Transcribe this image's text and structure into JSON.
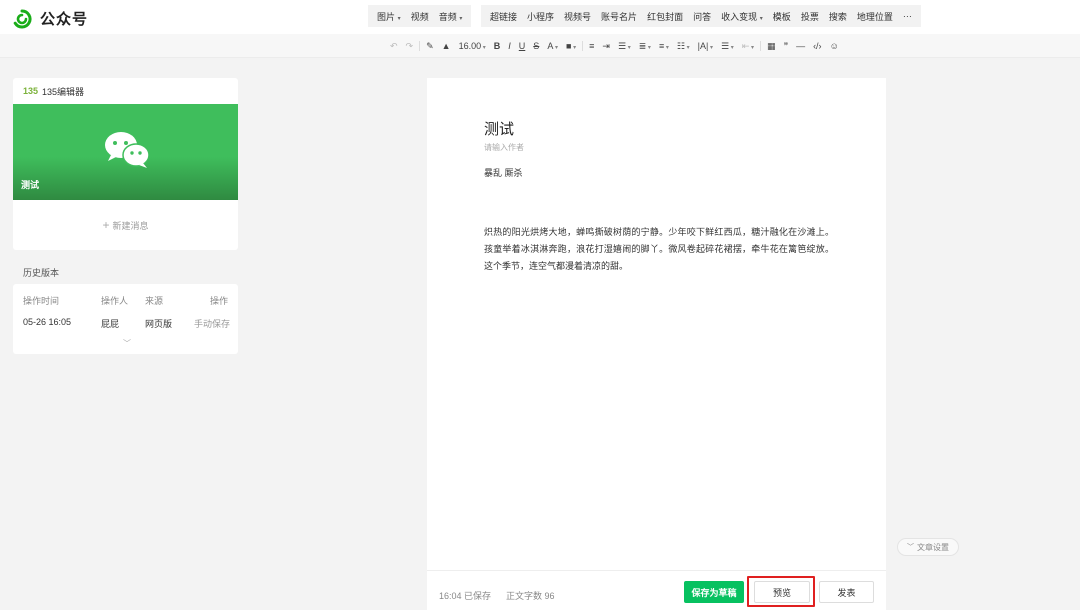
{
  "app": {
    "title": "公众号"
  },
  "topmenu": {
    "group1": [
      {
        "label": "图片",
        "dropdown": true
      },
      {
        "label": "视频",
        "dropdown": false
      },
      {
        "label": "音频",
        "dropdown": true
      }
    ],
    "group2": [
      {
        "label": "超链接",
        "dropdown": false
      },
      {
        "label": "小程序",
        "dropdown": false
      },
      {
        "label": "视频号",
        "dropdown": false
      },
      {
        "label": "账号名片",
        "dropdown": false
      },
      {
        "label": "红包封面",
        "dropdown": false
      },
      {
        "label": "问答",
        "dropdown": false
      },
      {
        "label": "收入变现",
        "dropdown": true
      },
      {
        "label": "模板",
        "dropdown": false
      },
      {
        "label": "投票",
        "dropdown": false
      },
      {
        "label": "搜索",
        "dropdown": false
      },
      {
        "label": "地理位置",
        "dropdown": false
      },
      {
        "label": "···",
        "dropdown": false
      }
    ]
  },
  "toolbar": {
    "font_size": "16.00",
    "icons": [
      "undo-icon",
      "redo-icon",
      "format-brush-icon",
      "clear-format-icon",
      "bold-icon",
      "italic-icon",
      "underline-icon",
      "strikethrough-icon",
      "font-color-icon",
      "background-color-icon",
      "align-icon",
      "indent-icon",
      "line-height-icon",
      "paragraph-spacing-icon",
      "letter-spacing-icon",
      "list-icon",
      "table-icon",
      "quote-icon",
      "divider-icon",
      "code-icon",
      "emoji-icon"
    ]
  },
  "left_panel": {
    "editor_brand": "135",
    "editor_name": "135编辑器",
    "cover_title": "测试",
    "new_message": "新建消息"
  },
  "history": {
    "title": "历史版本",
    "headers": {
      "time": "操作时间",
      "operator": "操作人",
      "source": "来源",
      "action": "操作"
    },
    "rows": [
      {
        "time": "05-26 16:05",
        "operator": "屁屁",
        "source": "网页版",
        "action": "手动保存"
      }
    ]
  },
  "article": {
    "title": "测试",
    "author_placeholder": "请输入作者",
    "digest": "暴乱 厮杀",
    "body": "炽热的阳光烘烤大地，蝉鸣撕破树荫的宁静。少年咬下鲜红西瓜，糖汁融化在沙滩上。孩童举着冰淇淋奔跑，浪花打湿嬉闹的脚丫。微风卷起碎花裙摆，牵牛花在篱笆绽放。这个季节，连空气都漫着清凉的甜。"
  },
  "footer": {
    "saved_time": "16:04",
    "saved_label": "已保存",
    "word_count_label": "正文字数",
    "word_count": "96",
    "save_draft": "保存为草稿",
    "preview": "预览",
    "publish": "发表"
  },
  "settings": {
    "label": "文章设置"
  },
  "colors": {
    "brand_green": "#07c160",
    "highlight_red": "#e02020"
  }
}
